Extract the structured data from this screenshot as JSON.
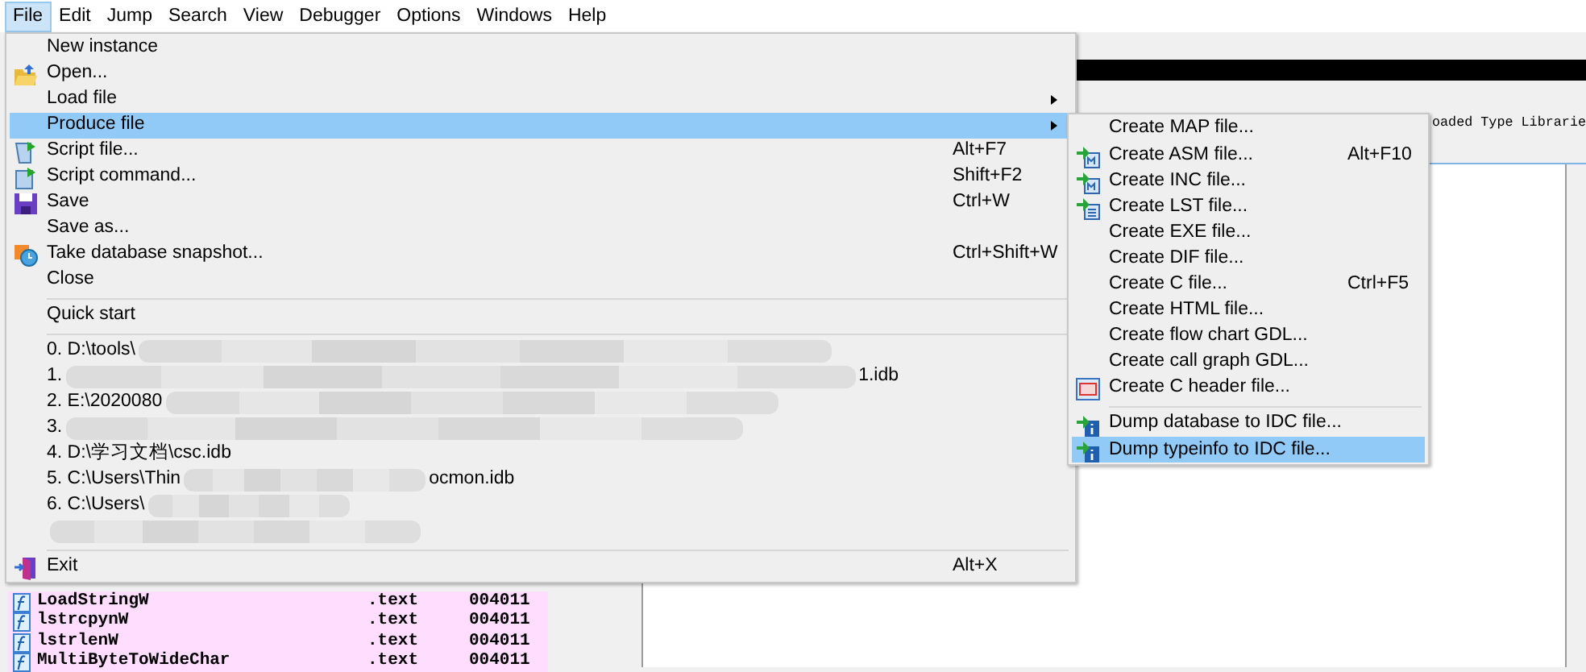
{
  "menubar": [
    {
      "label": "File",
      "selected": true
    },
    {
      "label": "Edit",
      "selected": false
    },
    {
      "label": "Jump",
      "selected": false
    },
    {
      "label": "Search",
      "selected": false
    },
    {
      "label": "View",
      "selected": false
    },
    {
      "label": "Debugger",
      "selected": false
    },
    {
      "label": "Options",
      "selected": false
    },
    {
      "label": "Windows",
      "selected": false
    },
    {
      "label": "Help",
      "selected": false
    }
  ],
  "background": {
    "tab_label": "oaded Type Librarie",
    "functions": [
      {
        "name": "LoadStringW",
        "segment": ".text",
        "address": "004011"
      },
      {
        "name": "lstrcpynW",
        "segment": ".text",
        "address": "004011"
      },
      {
        "name": "lstrlenW",
        "segment": ".text",
        "address": "004011"
      },
      {
        "name": "MultiByteToWideChar",
        "segment": ".text",
        "address": "004011"
      }
    ]
  },
  "file_menu": {
    "sections": [
      [
        {
          "label": "New instance",
          "selected": false
        },
        {
          "label": "Open...",
          "selected": false
        },
        {
          "label": "Load file",
          "submenu": true,
          "selected": false
        },
        {
          "label": "Produce file",
          "submenu": true,
          "selected": true
        },
        {
          "label": "Script file...",
          "shortcut": "Alt+F7",
          "selected": false
        },
        {
          "label": "Script command...",
          "shortcut": "Shift+F2",
          "selected": false
        },
        {
          "label": "Save",
          "shortcut": "Ctrl+W",
          "selected": false
        },
        {
          "label": "Save as...",
          "selected": false
        },
        {
          "label": "Take database snapshot...",
          "shortcut": "Ctrl+Shift+W",
          "selected": false
        },
        {
          "label": "Close",
          "selected": false
        }
      ],
      [
        {
          "label": "Quick start",
          "selected": false
        }
      ],
      [
        {
          "label": "0. D:\\tools\\",
          "kind": "recent",
          "selected": false
        },
        {
          "label": "1.",
          "suffix": "1.idb",
          "kind": "recent",
          "selected": false
        },
        {
          "label": "2. E:\\2020080",
          "kind": "recent",
          "selected": false
        },
        {
          "label": "3.",
          "kind": "recent",
          "selected": false
        },
        {
          "label": "4. D:\\学习文档\\csc.idb",
          "kind": "recent",
          "selected": false
        },
        {
          "label": "5. C:\\Users\\Thin",
          "suffix": "ocmon.idb",
          "kind": "recent",
          "selected": false
        },
        {
          "label": "6. C:\\Users\\",
          "kind": "recent",
          "selected": false
        },
        {
          "kind": "recent",
          "selected": false
        }
      ],
      [
        {
          "label": "Exit",
          "shortcut": "Alt+X",
          "selected": false
        }
      ]
    ]
  },
  "produce_submenu": {
    "sections": [
      [
        {
          "label": "Create MAP file...",
          "selected": false
        },
        {
          "label": "Create ASM file...",
          "shortcut": "Alt+F10",
          "selected": false
        },
        {
          "label": "Create INC file...",
          "selected": false
        },
        {
          "label": "Create LST file...",
          "selected": false
        },
        {
          "label": "Create EXE file...",
          "selected": false
        },
        {
          "label": "Create DIF file...",
          "selected": false
        },
        {
          "label": "Create C file...",
          "shortcut": "Ctrl+F5",
          "selected": false
        },
        {
          "label": "Create HTML file...",
          "selected": false
        },
        {
          "label": "Create flow chart GDL...",
          "selected": false
        },
        {
          "label": "Create call graph GDL...",
          "selected": false
        },
        {
          "label": "Create C header file...",
          "selected": false
        }
      ],
      [
        {
          "label": "Dump database to IDC file...",
          "selected": false
        },
        {
          "label": "Dump typeinfo to IDC file...",
          "selected": true
        }
      ]
    ]
  }
}
